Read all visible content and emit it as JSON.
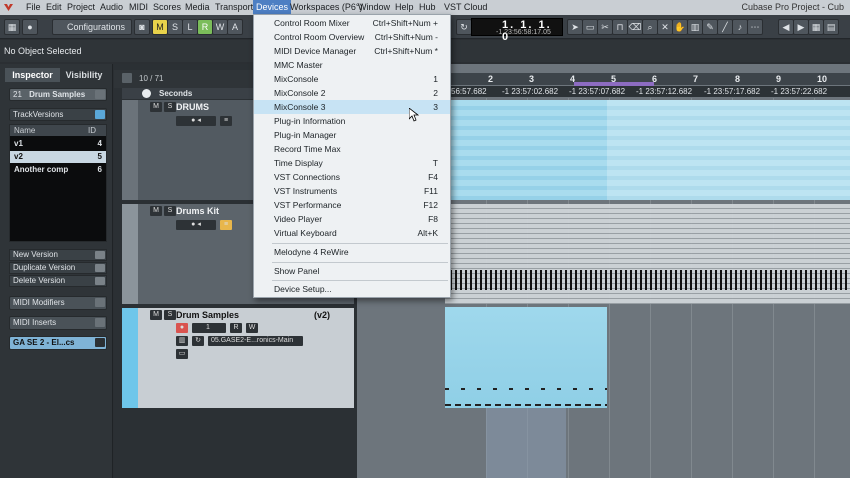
{
  "menubar": {
    "items": [
      "File",
      "Edit",
      "Project",
      "Audio",
      "MIDI",
      "Scores",
      "Media",
      "Transport",
      "Devices",
      "Workspaces (P6°)",
      "Window",
      "Help",
      "Hub",
      "VST Cloud"
    ],
    "active": "Devices",
    "window_title": "Cubase Pro Project - Cub"
  },
  "toolbar": {
    "configurations_label": "Configurations",
    "buttons": [
      "M",
      "S",
      "L",
      "R",
      "W",
      "A"
    ],
    "time_display_main": "1. 1. 1.  0",
    "time_display_sub": "-1 23:56:58:17.05"
  },
  "status": {
    "text": "No Object Selected"
  },
  "inspector": {
    "tabs": [
      "Inspector",
      "Visibility"
    ],
    "track_number": "21",
    "track_name": "Drum Samples",
    "track_versions_label": "TrackVersions",
    "table_headers": [
      "Name",
      "ID"
    ],
    "versions": [
      {
        "name": "v1",
        "id": "4"
      },
      {
        "name": "v2",
        "id": "5"
      },
      {
        "name": "Another comp",
        "id": "6"
      }
    ],
    "version_actions": [
      "New Version",
      "Duplicate Version",
      "Delete Version"
    ],
    "midi_modifiers": "MIDI Modifiers",
    "midi_inserts": "MIDI Inserts",
    "instrument": "GA SE 2 - El...cs"
  },
  "tracklist": {
    "count": "10 / 71",
    "ruler_label": "Seconds",
    "tracks": [
      {
        "name": "DRUMS",
        "version": ""
      },
      {
        "name": "Drums Kit",
        "version": ""
      },
      {
        "name": "Drum Samples",
        "version": "(v2)",
        "channel": "1",
        "output": "05.GASE2-E...ronics-Main"
      }
    ]
  },
  "ruler": {
    "bars": [
      "2",
      "3",
      "4",
      "5",
      "6",
      "7",
      "8",
      "9",
      "10"
    ],
    "seconds": [
      "56:57.682",
      "-1 23:57:02.682",
      "-1 23:57:07.682",
      "-1 23:57:12.682",
      "-1 23:57:17.682",
      "-1 23:57:22.682"
    ]
  },
  "devices_menu": {
    "items": [
      {
        "label": "Control Room Mixer",
        "shortcut": "Ctrl+Shift+Num +"
      },
      {
        "label": "Control Room Overview",
        "shortcut": "Ctrl+Shift+Num -"
      },
      {
        "label": "MIDI Device Manager",
        "shortcut": "Ctrl+Shift+Num *"
      },
      {
        "label": "MMC Master",
        "shortcut": ""
      },
      {
        "label": "MixConsole",
        "shortcut": "1"
      },
      {
        "label": "MixConsole 2",
        "shortcut": "2"
      },
      {
        "label": "MixConsole 3",
        "shortcut": "3"
      },
      {
        "label": "Plug-in Information",
        "shortcut": ""
      },
      {
        "label": "Plug-in Manager",
        "shortcut": ""
      },
      {
        "label": "Record Time Max",
        "shortcut": ""
      },
      {
        "label": "Time Display",
        "shortcut": "T"
      },
      {
        "label": "VST Connections",
        "shortcut": "F4"
      },
      {
        "label": "VST Instruments",
        "shortcut": "F11"
      },
      {
        "label": "VST Performance",
        "shortcut": "F12"
      },
      {
        "label": "Video Player",
        "shortcut": "F8"
      },
      {
        "label": "Virtual Keyboard",
        "shortcut": "Alt+K"
      },
      {
        "label": "Melodyne 4 ReWire",
        "shortcut": ""
      },
      {
        "label": "Show Panel",
        "shortcut": ""
      },
      {
        "label": "Device Setup...",
        "shortcut": ""
      }
    ],
    "highlighted": "MixConsole 3"
  },
  "colors": {
    "menu_highlight": "#c7e3f4",
    "active_menu": "#4d7fc3",
    "audio_part": "#9fd8ec",
    "locator": "#8d6cc1"
  }
}
